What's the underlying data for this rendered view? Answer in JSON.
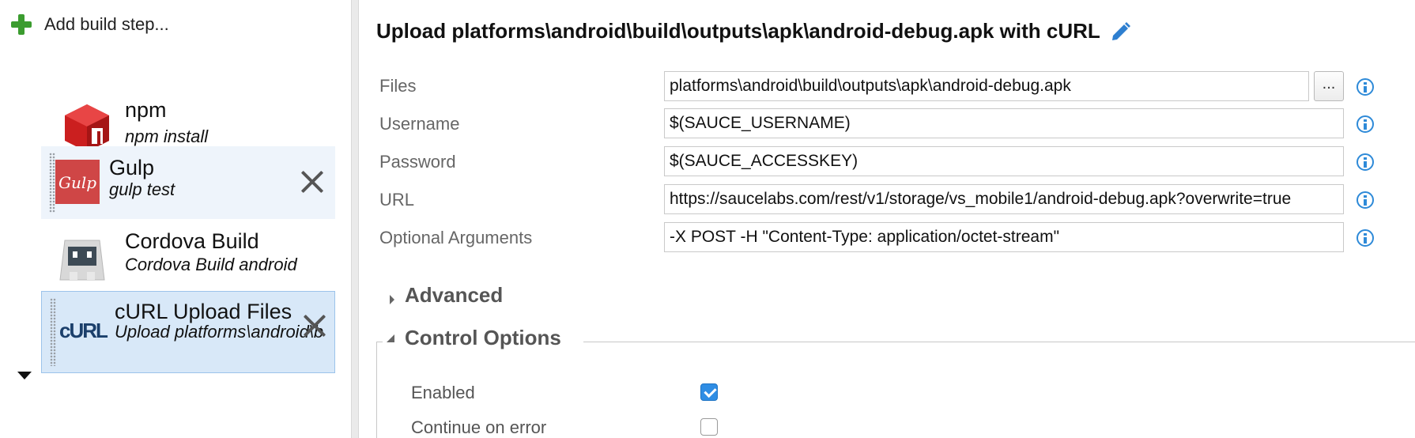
{
  "toolbar": {
    "add_step_label": "Add build step..."
  },
  "steps": [
    {
      "name": "npm",
      "description": "npm install",
      "icon": "npm-icon"
    },
    {
      "name": "Gulp",
      "description": "gulp test",
      "icon": "gulp-icon",
      "icon_text": "Gulp"
    },
    {
      "name": "Cordova Build",
      "description": "Cordova Build android",
      "icon": "cordova-icon"
    },
    {
      "name": "cURL Upload Files",
      "description": "Upload platforms\\android\\build\\outputs\\apk\\android-debug.apk with cURL",
      "icon": "curl-icon",
      "icon_text": "cURL"
    }
  ],
  "task": {
    "title": "Upload platforms\\android\\build\\outputs\\apk\\android-debug.apk with cURL",
    "fields": {
      "files": {
        "label": "Files",
        "value": "platforms\\android\\build\\outputs\\apk\\android-debug.apk",
        "browse_label": "..."
      },
      "username": {
        "label": "Username",
        "value": "$(SAUCE_USERNAME)"
      },
      "password": {
        "label": "Password",
        "value": "$(SAUCE_ACCESSKEY)"
      },
      "url": {
        "label": "URL",
        "value": "https://saucelabs.com/rest/v1/storage/vs_mobile1/android-debug.apk?overwrite=true"
      },
      "optional_arguments": {
        "label": "Optional Arguments",
        "value": "-X POST -H \"Content-Type: application/octet-stream\""
      }
    }
  },
  "sections": {
    "advanced": {
      "title": "Advanced",
      "expanded": false
    },
    "control_options": {
      "title": "Control Options",
      "expanded": true,
      "enabled": {
        "label": "Enabled",
        "checked": true
      },
      "continue_on_error": {
        "label": "Continue on error",
        "checked": false
      }
    }
  },
  "colors": {
    "accent": "#2f8de4",
    "selected_bg": "#d8e8f8",
    "add_green": "#3b9c2f",
    "npm_red": "#cb1f1f",
    "gulp_red": "#cf4646"
  }
}
